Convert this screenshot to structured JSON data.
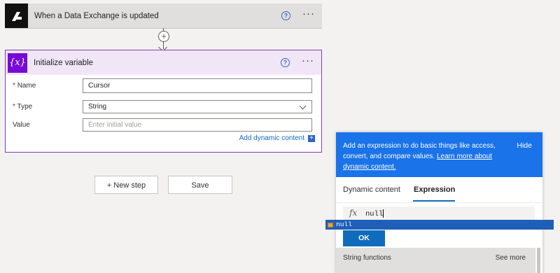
{
  "trigger": {
    "title": "When a Data Exchange is updated",
    "help_glyph": "?",
    "more_glyph": "···",
    "icon": "brand-logo-icon"
  },
  "connector": {
    "add_glyph": "+"
  },
  "action": {
    "title": "Initialize variable",
    "icon_text": "{x}",
    "help_glyph": "?",
    "more_glyph": "···",
    "fields": {
      "name_label": "Name",
      "name_value": "Cursor",
      "type_label": "Type",
      "type_value": "String",
      "value_label": "Value",
      "value_placeholder": "Enter initial value"
    },
    "required_mark": "*",
    "dynamic_link": "Add dynamic content",
    "dynamic_plus": "+"
  },
  "buttons": {
    "new_step": "+ New step",
    "save": "Save"
  },
  "panel": {
    "description_pre": "Add an expression to do basic things like access, convert, and compare values.",
    "learn_more": "Learn more about dynamic content.",
    "hide": "Hide",
    "tabs": [
      "Dynamic content",
      "Expression"
    ],
    "fx": "fx",
    "expression": "null",
    "ok": "OK",
    "functions_title": "String functions",
    "see_more": "See more"
  },
  "suggestion": {
    "text": "null"
  },
  "colors": {
    "accent_blue": "#1a73e8",
    "variable_purple": "#770bd6",
    "card_border": "#7f3fbf"
  }
}
